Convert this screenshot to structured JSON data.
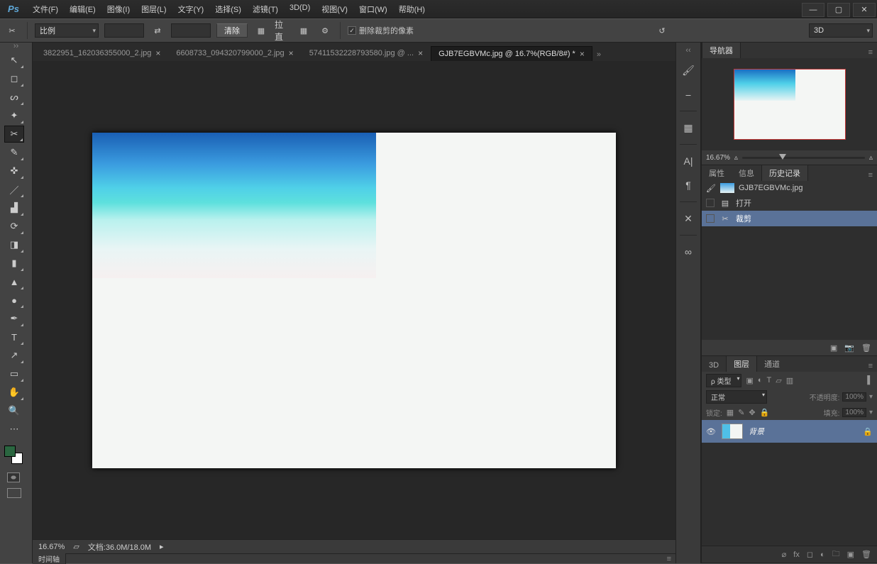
{
  "app": "Ps",
  "menu": [
    "文件(F)",
    "编辑(E)",
    "图像(I)",
    "图层(L)",
    "文字(Y)",
    "选择(S)",
    "滤镜(T)",
    "3D(D)",
    "视图(V)",
    "窗口(W)",
    "帮助(H)"
  ],
  "options": {
    "ratio_label": "比例",
    "clear": "清除",
    "straighten": "拉直",
    "delete_crop": "删除裁剪的像素",
    "mode_3d": "3D"
  },
  "tabs": [
    {
      "label": "3822951_162036355000_2.jpg",
      "active": false,
      "close": true
    },
    {
      "label": "6608733_094320799000_2.jpg",
      "active": false,
      "close": true
    },
    {
      "label": "57411532228793580.jpg @ ...",
      "active": false,
      "close": true
    },
    {
      "label": "GJB7EGBVMc.jpg @ 16.7%(RGB/8#) *",
      "active": true,
      "close": true
    }
  ],
  "status": {
    "zoom": "16.67%",
    "doc": "文档:36.0M/18.0M"
  },
  "timeline_tab": "时间轴",
  "navigator": {
    "tab": "导航器",
    "zoom": "16.67%"
  },
  "info_tabs": [
    "属性",
    "信息",
    "历史记录"
  ],
  "history": {
    "file": "GJB7EGBVMc.jpg",
    "items": [
      {
        "name": "打开",
        "sel": false,
        "icon": "▤"
      },
      {
        "name": "裁剪",
        "sel": true,
        "icon": "✂"
      }
    ]
  },
  "layer_tabs": [
    "3D",
    "图层",
    "通道"
  ],
  "layers": {
    "kind": "类型",
    "blend": "正常",
    "opacity_label": "不透明度:",
    "opacity": "100%",
    "lock_label": "锁定:",
    "fill_label": "填充:",
    "fill": "100%",
    "item": "背景"
  }
}
